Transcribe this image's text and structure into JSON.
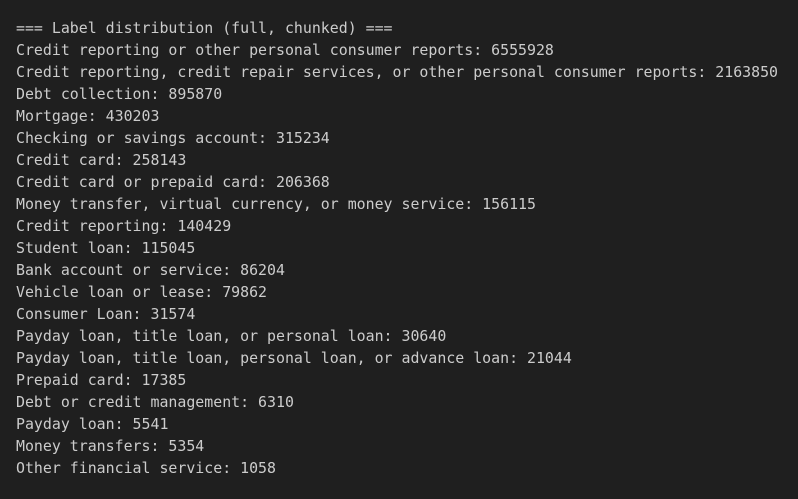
{
  "output": {
    "header": "=== Label distribution (full, chunked) ===",
    "lines": [
      "Credit reporting or other personal consumer reports: 6555928",
      "Credit reporting, credit repair services, or other personal consumer reports: 2163850",
      "Debt collection: 895870",
      "Mortgage: 430203",
      "Checking or savings account: 315234",
      "Credit card: 258143",
      "Credit card or prepaid card: 206368",
      "Money transfer, virtual currency, or money service: 156115",
      "Credit reporting: 140429",
      "Student loan: 115045",
      "Bank account or service: 86204",
      "Vehicle loan or lease: 79862",
      "Consumer Loan: 31574",
      "Payday loan, title loan, or personal loan: 30640",
      "Payday loan, title loan, personal loan, or advance loan: 21044",
      "Prepaid card: 17385",
      "Debt or credit management: 6310",
      "Payday loan: 5541",
      "Money transfers: 5354",
      "Other financial service: 1058"
    ]
  },
  "colors": {
    "background": "#1f1f1f",
    "text": "#cccccc"
  }
}
